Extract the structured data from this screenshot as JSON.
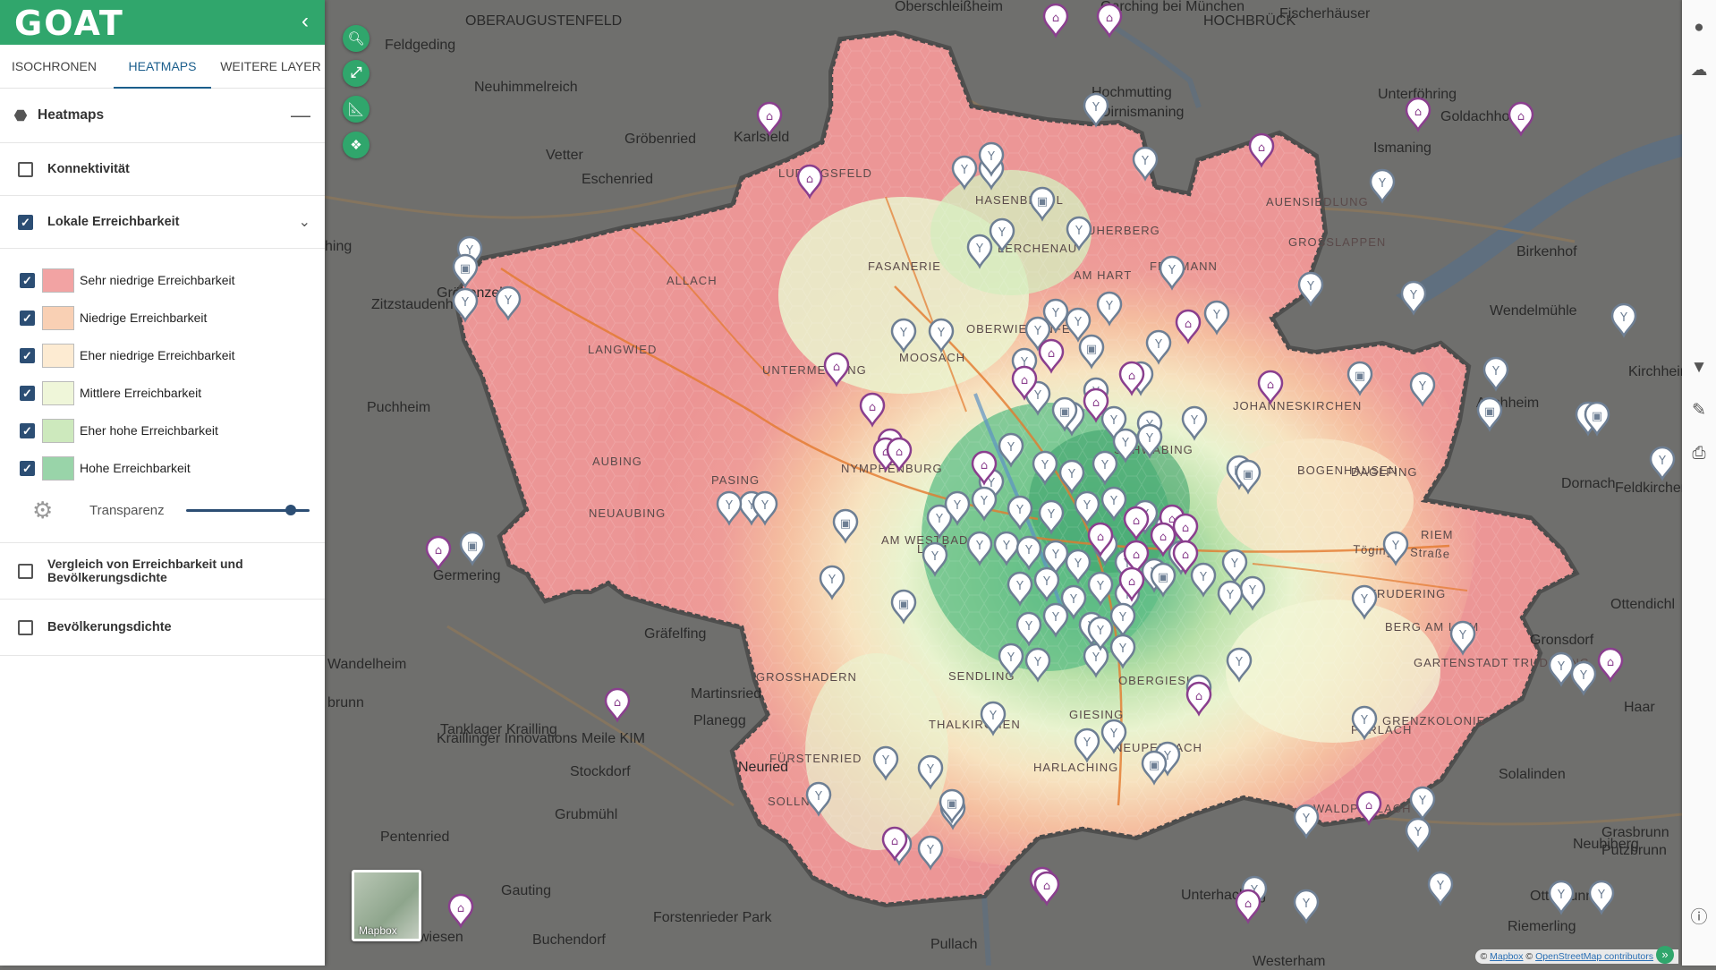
{
  "app": {
    "logo": "GOAT",
    "collapse_icon": "chevron-left-icon"
  },
  "tabs": [
    {
      "label": "ISOCHRONEN",
      "active": false
    },
    {
      "label": "HEATMAPS",
      "active": true
    },
    {
      "label": "WEITERE LAYER",
      "active": false
    }
  ],
  "heatmaps": {
    "title": "Heatmaps",
    "collapse_symbol": "—",
    "layers": {
      "konnektivitaet": {
        "label": "Konnektivität",
        "checked": false
      },
      "lokale": {
        "label": "Lokale Erreichbarkeit",
        "checked": true,
        "expanded": true
      }
    },
    "legend": [
      {
        "label": "Sehr niedrige Erreichbarkeit",
        "color": "#f2a3a3",
        "checked": true
      },
      {
        "label": "Niedrige Erreichbarkeit",
        "color": "#f9d0b4",
        "checked": true
      },
      {
        "label": "Eher niedrige Erreichbarkeit",
        "color": "#fdebd2",
        "checked": true
      },
      {
        "label": "Mittlere Erreichbarkeit",
        "color": "#eff6d9",
        "checked": true
      },
      {
        "label": "Eher hohe Erreichbarkeit",
        "color": "#cde9bd",
        "checked": true
      },
      {
        "label": "Hohe Erreichbarkeit",
        "color": "#99d4a9",
        "checked": true
      }
    ],
    "transparency": {
      "label": "Transparenz",
      "value": 0.85
    },
    "vergleich": {
      "label": "Vergleich von Erreichbarkeit und Bevölkerungsdichte",
      "checked": false
    },
    "bevoelkerung": {
      "label": "Bevölkerungsdichte",
      "checked": false
    }
  },
  "map_controls": [
    "search-icon",
    "fullscreen-exit-icon",
    "measure-icon",
    "layers-tool-icon"
  ],
  "right_bar": [
    "account-icon",
    "cloud-icon",
    "filter-icon",
    "edit-icon",
    "print-icon",
    "info-icon"
  ],
  "basemap": {
    "label": "Mapbox"
  },
  "attribution": {
    "prefix": "©",
    "mapbox": "Mapbox",
    "sep": "©",
    "osm": "OpenStreetMap contributors"
  },
  "map_labels": {
    "outer": [
      "Oberschleißheim",
      "Garching bei München",
      "Fischerhäuser",
      "HOCHBRÜCK",
      "OBERAUGUSTENFELD",
      "Feldgeding",
      "Neuhimmelreich",
      "Hochmutting",
      "Dirnismaning",
      "Goldachhof",
      "Ismaning",
      "Karlsfeld",
      "Gröbenried",
      "Eschenried",
      "Vetter",
      "ching",
      "Zitzstaudenhof",
      "Gröbenzell",
      "Birkenhof",
      "Wendelmühle",
      "Puchheim",
      "Aschheim",
      "Kirchheim",
      "Dornach",
      "Feldkirchen",
      "Haar",
      "Ottendichl",
      "Gronsdorf",
      "Solalinden",
      "Putzbrunn",
      "Grasbrunn",
      "Neubiberg",
      "Ottobrunn",
      "Riemerling",
      "Unterhaching",
      "Pullach",
      "Gauting",
      "Buchendorf",
      "Forstenrieder Park",
      "Planegg",
      "Martinsried",
      "Neuried",
      "Stockdorf",
      "Gräfelfing",
      "Germering",
      "Grubmühl",
      "Pentenried",
      "Kraillinger Innovations Meile KIM",
      "Tanklager Krailling",
      "Wandelheim",
      "brunn",
      "swiesen",
      "Westerham",
      "Unterföhring"
    ],
    "inner": [
      "LUDWIGSFELD",
      "FASANERIE",
      "HASENBERGL",
      "NEUHERBERG",
      "LERCHENAU",
      "AM HART",
      "FREIMANN",
      "AUENSIEDLUNG",
      "GROSSLAPPEN",
      "ALLACH",
      "UNTERMENZING",
      "OBERWIESENFELD",
      "MOOSACH",
      "LANGWIED",
      "AUBING",
      "NEUAUBING",
      "PASING",
      "LAIM",
      "AM WESTBAD",
      "JOHANNESKIRCHEN",
      "DAGLFING",
      "RIEM",
      "TRUDERING",
      "GARTENSTADT TRUDERING",
      "BERG AM LAIM",
      "GROSSHADERN",
      "FÜRSTENRIED",
      "SENDLING",
      "GIESING",
      "HARLACHING",
      "PERLACH",
      "WALDPERLACH",
      "GRENZKOLONIE",
      "OBERGIESING",
      "SCHWABING",
      "NYMPHENBURG",
      "BOGENHAUSEN",
      "NEUPERLACH",
      "SOLLN",
      "THALKIRCHEN"
    ],
    "roads": [
      "Töginger Straße"
    ]
  }
}
